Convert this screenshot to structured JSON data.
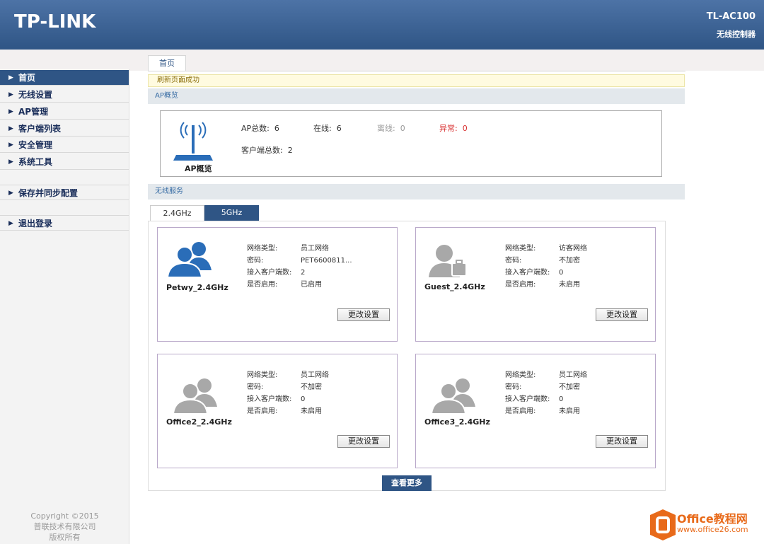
{
  "header": {
    "logo": "TP-LINK",
    "model": "TL-AC100",
    "model_subtitle": "无线控制器"
  },
  "sidebar": {
    "items": [
      {
        "label": "首页",
        "active": true
      },
      {
        "label": "无线设置"
      },
      {
        "label": "AP管理"
      },
      {
        "label": "客户端列表"
      },
      {
        "label": "安全管理"
      },
      {
        "label": "系统工具"
      },
      {
        "label": "保存并同步配置"
      },
      {
        "label": "退出登录"
      }
    ],
    "copyright": [
      "Copyright ©2015",
      "普联技术有限公司",
      "版权所有"
    ]
  },
  "main": {
    "tab": "首页",
    "notice": "刷新页面成功",
    "ap_section_title": "AP概览",
    "ap": {
      "icon_label": "AP概览",
      "total_label": "AP总数:",
      "total": "6",
      "online_label": "在线:",
      "online": "6",
      "offline_label": "离线:",
      "offline": "0",
      "abnormal_label": "异常:",
      "abnormal": "0",
      "clients_label": "客户端总数:",
      "clients": "2"
    },
    "wireless_section_title": "无线服务",
    "band_tabs": [
      "2.4GHz",
      "5GHz"
    ],
    "field_labels": {
      "type": "网络类型:",
      "password": "密码:",
      "clients": "接入客户端数:",
      "enabled": "是否启用:"
    },
    "cards": [
      {
        "ssid": "Petwy_2.4GHz",
        "type": "员工网络",
        "password": "PET6600811...",
        "clients": "2",
        "enabled": "已启用",
        "button": "更改设置",
        "icon": "users-blue-icon"
      },
      {
        "ssid": "Guest_2.4GHz",
        "type": "访客网络",
        "password": "不加密",
        "clients": "0",
        "enabled": "未启用",
        "button": "更改设置",
        "icon": "guest-user-icon"
      },
      {
        "ssid": "Office2_2.4GHz",
        "type": "员工网络",
        "password": "不加密",
        "clients": "0",
        "enabled": "未启用",
        "button": "更改设置",
        "icon": "users-gray-icon"
      },
      {
        "ssid": "Office3_2.4GHz",
        "type": "员工网络",
        "password": "不加密",
        "clients": "0",
        "enabled": "未启用",
        "button": "更改设置",
        "icon": "users-gray-icon"
      }
    ],
    "more_button": "查看更多"
  },
  "watermark": {
    "title": "Office教程网",
    "url": "www.office26.com"
  },
  "colors": {
    "header": "#2f5585",
    "user_blue": "#2a6db8",
    "user_gray": "#a8a8a8",
    "abnormal_red": "#d83030"
  }
}
